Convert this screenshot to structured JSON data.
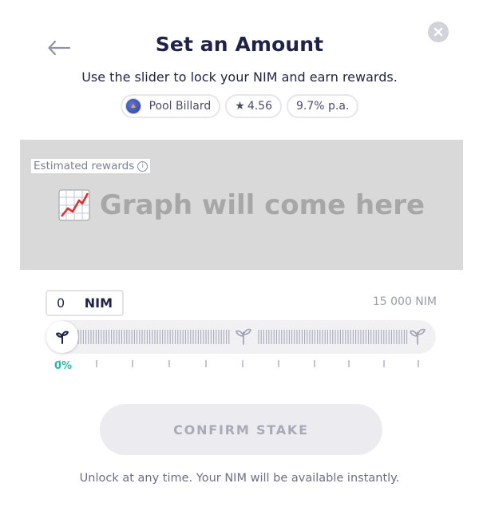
{
  "header": {
    "title": "Set an Amount",
    "subtitle": "Use the slider to lock your NIM and earn rewards."
  },
  "validator": {
    "name": "Pool Billard",
    "rating": "4.56",
    "reward": "9.7% p.a."
  },
  "graph": {
    "label": "Estimated rewards",
    "placeholder": "Graph will come here",
    "icon": "chart-increasing-emoji"
  },
  "amount": {
    "value": "0",
    "unit": "NIM",
    "max_label": "15 000 NIM"
  },
  "slider": {
    "percent_label": "0%",
    "fraction": 0
  },
  "actions": {
    "confirm_label": "CONFIRM STAKE"
  },
  "footer": {
    "note": "Unlock at any time. Your NIM will be available instantly."
  },
  "colors": {
    "accent": "#21bca5",
    "text": "#1f2348",
    "placeholder_bg": "#d9d9d9"
  }
}
